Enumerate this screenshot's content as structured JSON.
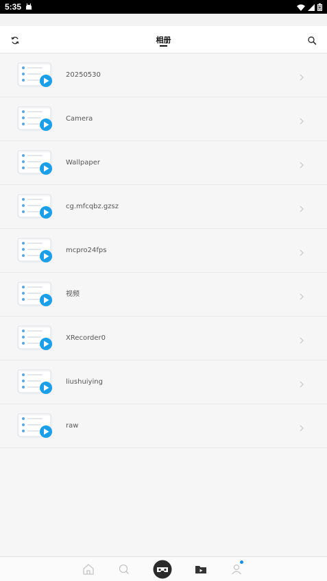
{
  "status_bar": {
    "time": "5:35",
    "icons": [
      "android-notification-icon",
      "wifi-icon",
      "signal-icon",
      "battery-icon"
    ]
  },
  "header": {
    "title": "相册",
    "left_icon": "refresh-icon",
    "right_icon": "search-icon"
  },
  "albums": [
    {
      "name": "20250530"
    },
    {
      "name": "Camera"
    },
    {
      "name": "Wallpaper"
    },
    {
      "name": "cg.mfcqbz.gzsz"
    },
    {
      "name": "mcpro24fps"
    },
    {
      "name": "视频"
    },
    {
      "name": "XRecorder0"
    },
    {
      "name": "liushuiying"
    },
    {
      "name": "raw"
    }
  ],
  "bottom_nav": {
    "items": [
      "home-icon",
      "search-icon",
      "vr-glasses-icon",
      "video-folder-icon",
      "profile-icon"
    ],
    "active": "vr-glasses-icon"
  },
  "colors": {
    "accent": "#1a9fe8",
    "notification_dot": "#1a8fe3"
  }
}
